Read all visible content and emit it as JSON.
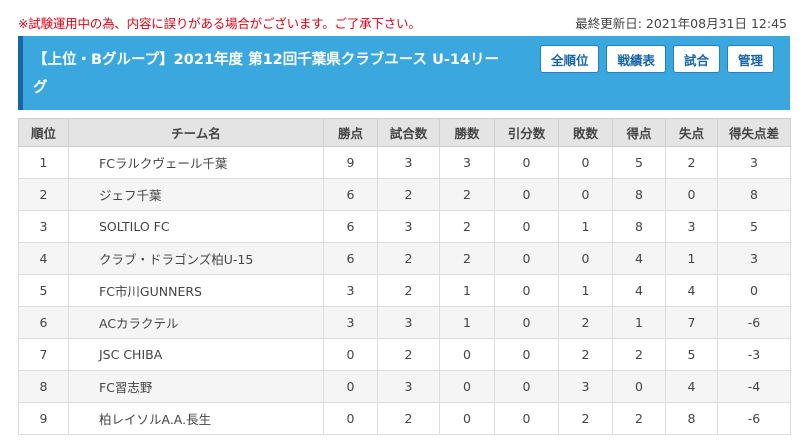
{
  "notice": "※試験運用中の為、内容に誤りがある場合がございます。ご了承下さい。",
  "updated": "最終更新日: 2021年08月31日 12:45",
  "header": {
    "title": "【上位・Bグループ】2021年度 第12回千葉県クラブユース U-14リーグ",
    "buttons": {
      "all_rank": "全順位",
      "results": "戦績表",
      "matches": "試合",
      "manage": "管理"
    }
  },
  "table": {
    "headers": {
      "rank": "順位",
      "team": "チーム名",
      "points": "勝点",
      "played": "試合数",
      "wins": "勝数",
      "draws": "引分数",
      "losses": "敗数",
      "gf": "得点",
      "ga": "失点",
      "gd": "得失点差"
    },
    "rows": [
      {
        "rank": "1",
        "team": "FCラルクヴェール千葉",
        "points": "9",
        "played": "3",
        "wins": "3",
        "draws": "0",
        "losses": "0",
        "gf": "5",
        "ga": "2",
        "gd": "3"
      },
      {
        "rank": "2",
        "team": "ジェフ千葉",
        "points": "6",
        "played": "2",
        "wins": "2",
        "draws": "0",
        "losses": "0",
        "gf": "8",
        "ga": "0",
        "gd": "8"
      },
      {
        "rank": "3",
        "team": "SOLTILO FC",
        "points": "6",
        "played": "3",
        "wins": "2",
        "draws": "0",
        "losses": "1",
        "gf": "8",
        "ga": "3",
        "gd": "5"
      },
      {
        "rank": "4",
        "team": "クラブ・ドラゴンズ柏U-15",
        "points": "6",
        "played": "2",
        "wins": "2",
        "draws": "0",
        "losses": "0",
        "gf": "4",
        "ga": "1",
        "gd": "3"
      },
      {
        "rank": "5",
        "team": "FC市川GUNNERS",
        "points": "3",
        "played": "2",
        "wins": "1",
        "draws": "0",
        "losses": "1",
        "gf": "4",
        "ga": "4",
        "gd": "0"
      },
      {
        "rank": "6",
        "team": "ACカラクテル",
        "points": "3",
        "played": "3",
        "wins": "1",
        "draws": "0",
        "losses": "2",
        "gf": "1",
        "ga": "7",
        "gd": "-6"
      },
      {
        "rank": "7",
        "team": "JSC CHIBA",
        "points": "0",
        "played": "2",
        "wins": "0",
        "draws": "0",
        "losses": "2",
        "gf": "2",
        "ga": "5",
        "gd": "-3"
      },
      {
        "rank": "8",
        "team": "FC習志野",
        "points": "0",
        "played": "3",
        "wins": "0",
        "draws": "0",
        "losses": "3",
        "gf": "0",
        "ga": "4",
        "gd": "-4"
      },
      {
        "rank": "9",
        "team": "柏レイソルA.A.長生",
        "points": "0",
        "played": "2",
        "wins": "0",
        "draws": "0",
        "losses": "2",
        "gf": "2",
        "ga": "8",
        "gd": "-6"
      }
    ]
  }
}
